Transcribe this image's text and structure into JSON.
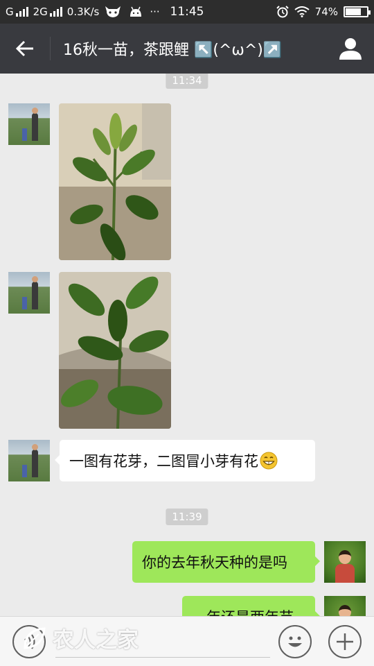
{
  "status_bar": {
    "network_1": "G",
    "network_2": "2G",
    "speed": "0.3K/s",
    "more": "···",
    "time": "11:45",
    "battery": "74%",
    "battery_level": 0.74
  },
  "header": {
    "title": "16秋一苗，茶跟鲤 ↖️(^ω^)↗️"
  },
  "chat": {
    "messages": [
      {
        "type": "time",
        "text": "11:34"
      },
      {
        "type": "image",
        "direction": "in",
        "content": "plant-photo-1"
      },
      {
        "type": "image",
        "direction": "in",
        "content": "plant-photo-2"
      },
      {
        "type": "text",
        "direction": "in",
        "text": "一图有花芽，二图冒小芽有花",
        "emoji": "grinning-face"
      },
      {
        "type": "time",
        "text": "11:39"
      },
      {
        "type": "text",
        "direction": "out",
        "text": "你的去年秋天种的是吗"
      },
      {
        "type": "text",
        "direction": "out",
        "text": "一年还是两年苗"
      }
    ]
  },
  "input_bar": {
    "watermark": "农人之家"
  },
  "colors": {
    "status_bar": "#2d2d2d",
    "title_bar": "#393a3f",
    "chat_bg": "#ebebeb",
    "bubble_in": "#ffffff",
    "bubble_out": "#9ee75a"
  }
}
